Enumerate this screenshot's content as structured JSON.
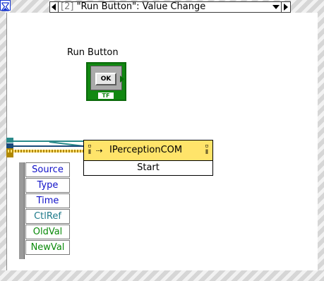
{
  "event_structure": {
    "case_index": "[2]",
    "case_label": "\"Run Button\": Value Change"
  },
  "run_button": {
    "label": "Run Button",
    "button_text": "OK",
    "type_badge": "TF"
  },
  "invoke_node": {
    "class_name": "IPerceptionCOM",
    "method": "Start"
  },
  "event_data": {
    "items": [
      "Source",
      "Type",
      "Time",
      "CtlRef",
      "OldVal",
      "NewVal"
    ]
  },
  "colors": {
    "frame_hatch": "#d6d6d6",
    "invoke_header": "#ffe46a",
    "boolean_green": "#118811",
    "refnum_teal": "#2a8a8a",
    "item_blue": "#1010c8"
  }
}
